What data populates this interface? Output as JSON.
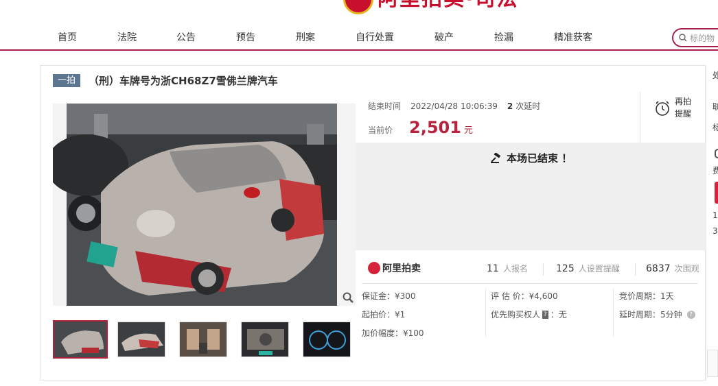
{
  "header": {
    "logo_text": "阿里拍卖·司法"
  },
  "nav": {
    "items": [
      "首页",
      "法院",
      "公告",
      "预告",
      "刑案",
      "自行处置",
      "破产",
      "捡漏",
      "精准获客"
    ],
    "search_placeholder": "标的物"
  },
  "item": {
    "badge": "一拍",
    "title": "（刑）车牌号为浙CH68Z7雪佛兰牌汽车",
    "end_label": "结束时间",
    "end_time": "2022/04/28 10:06:39",
    "delay_count": "2",
    "delay_label": "次延时",
    "price_label": "当前价",
    "price": "2,501",
    "price_unit": "元",
    "remind_label": "再拍提醒",
    "ended_text": "本场已结束 ！"
  },
  "stats": {
    "platform": "阿里拍卖",
    "signups": "11",
    "signups_label": "人报名",
    "reminders": "125",
    "reminders_label": "人设置提醒",
    "views": "6837",
    "views_label": "次围观"
  },
  "details": {
    "deposit": "保证金：¥300",
    "start_price": "起拍价：¥1",
    "increment": "加价幅度：¥100",
    "appraisal": "评 估 价：¥4,600",
    "priority_label": "优先购买权人",
    "priority_badge": "?",
    "priority_value": "：无",
    "cycle": "竞价周期：1天",
    "delay_cycle": "延时周期：5分钟",
    "help": "?"
  },
  "sidebar": {
    "t1": "处",
    "t2": "联",
    "t3": "标",
    "t4": "费",
    "t5": "1",
    "t6": "3"
  },
  "colors": {
    "accent": "#b8233f",
    "nav_border": "#a61e4d",
    "badge": "#5c7590"
  }
}
